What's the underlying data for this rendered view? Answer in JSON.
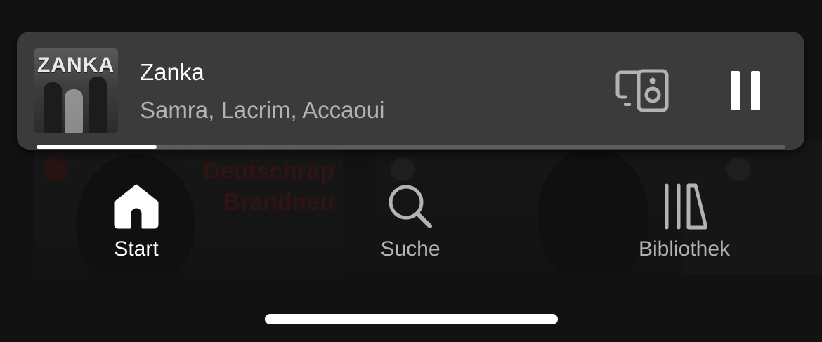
{
  "now_playing": {
    "cover_text": "ZANKA",
    "title": "Zanka",
    "artists": "Samra, Lacrim, Accaoui",
    "progress_fraction": 0.16
  },
  "background": {
    "card_title": "Deutschrap Brandneu"
  },
  "nav": {
    "items": [
      {
        "label": "Start",
        "icon": "home-icon",
        "active": true
      },
      {
        "label": "Suche",
        "icon": "search-icon",
        "active": false
      },
      {
        "label": "Bibliothek",
        "icon": "library-icon",
        "active": false
      }
    ]
  },
  "colors": {
    "background": "#121212",
    "player": "#3b3b3b",
    "text_primary": "#ffffff",
    "text_secondary": "#b3b3b3"
  }
}
